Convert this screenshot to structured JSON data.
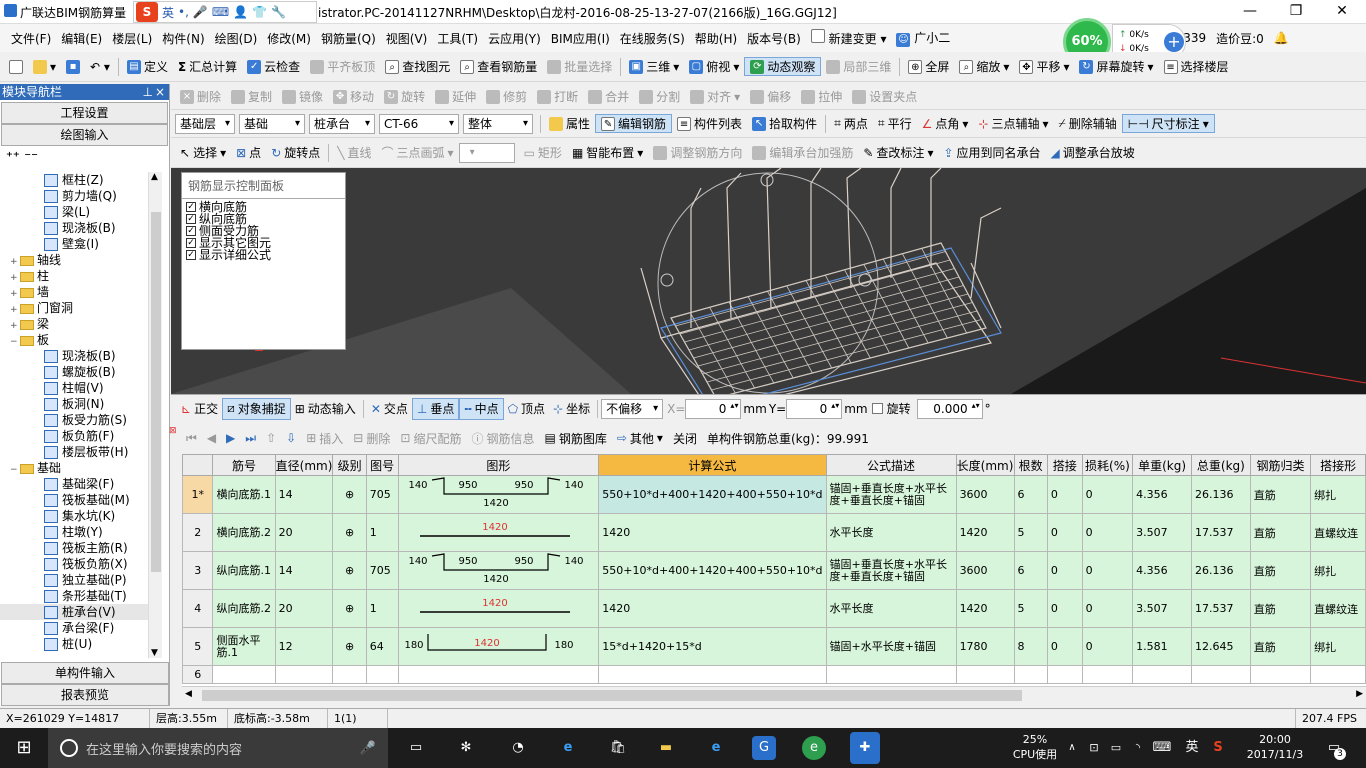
{
  "titlebar": {
    "app": "广联达BIM钢筋算量",
    "title": "istrator.PC-20141127NRHM\\Desktop\\白龙村-2016-08-25-13-27-07(2166版)_16G.GGJ12]",
    "ime_logo": "S",
    "ime_lang": "英",
    "min": "—",
    "max": "❐",
    "close": "✕"
  },
  "menu": [
    "文件(F)",
    "编辑(E)",
    "楼层(L)",
    "构件(N)",
    "绘图(D)",
    "修改(M)",
    "钢筋量(Q)",
    "视图(V)",
    "工具(T)",
    "云应用(Y)",
    "BIM应用(I)",
    "在线服务(S)",
    "帮助(H)",
    "版本号(B)",
    "新建变更",
    "广小二"
  ],
  "menu_right": {
    "num": "298339",
    "price": "造价豆:0"
  },
  "gauge": {
    "percent": "60%",
    "up": "0K/s",
    "down": "0K/s"
  },
  "toolbar1": [
    "定义",
    "汇总计算",
    "云检查",
    "平齐板顶",
    "查找图元",
    "查看钢筋量",
    "批量选择",
    "三维",
    "俯视",
    "动态观察",
    "局部三维",
    "全屏",
    "缩放",
    "平移",
    "屏幕旋转",
    "选择楼层"
  ],
  "toolbar2": [
    "删除",
    "复制",
    "镜像",
    "移动",
    "旋转",
    "延伸",
    "修剪",
    "打断",
    "合并",
    "分割",
    "对齐",
    "偏移",
    "拉伸",
    "设置夹点"
  ],
  "toolbar3": {
    "floor": "基础层",
    "type": "基础",
    "comp": "桩承台",
    "name": "CT-66",
    "mode": "整体",
    "items": [
      "属性",
      "编辑钢筋",
      "构件列表",
      "拾取构件",
      "两点",
      "平行",
      "点角",
      "三点辅轴",
      "删除辅轴",
      "尺寸标注"
    ]
  },
  "toolbar4": [
    "选择",
    "点",
    "旋转点",
    "直线",
    "三点画弧",
    "矩形",
    "智能布置",
    "调整钢筋方向",
    "编辑承台加强筋",
    "查改标注",
    "应用到同名承台",
    "调整承台放坡"
  ],
  "leftpanel": {
    "header": "模块导航栏",
    "pin": "⊥",
    "close": "×",
    "btn_project": "工程设置",
    "btn_draw": "绘图输入",
    "btn_single": "单构件输入",
    "btn_report": "报表预览"
  },
  "tree": [
    {
      "level": 2,
      "label": "框柱(Z)",
      "type": "leaf"
    },
    {
      "level": 2,
      "label": "剪力墙(Q)",
      "type": "leaf"
    },
    {
      "level": 2,
      "label": "梁(L)",
      "type": "leaf"
    },
    {
      "level": 2,
      "label": "现浇板(B)",
      "type": "leaf"
    },
    {
      "level": 2,
      "label": "壁龛(I)",
      "type": "leaf"
    },
    {
      "level": 1,
      "label": "轴线",
      "type": "folder",
      "exp": "+"
    },
    {
      "level": 1,
      "label": "柱",
      "type": "folder",
      "exp": "+"
    },
    {
      "level": 1,
      "label": "墙",
      "type": "folder",
      "exp": "+"
    },
    {
      "level": 1,
      "label": "门窗洞",
      "type": "folder",
      "exp": "+"
    },
    {
      "level": 1,
      "label": "梁",
      "type": "folder",
      "exp": "+"
    },
    {
      "level": 1,
      "label": "板",
      "type": "folder",
      "exp": "−"
    },
    {
      "level": 2,
      "label": "现浇板(B)",
      "type": "leaf"
    },
    {
      "level": 2,
      "label": "螺旋板(B)",
      "type": "leaf"
    },
    {
      "level": 2,
      "label": "柱帽(V)",
      "type": "leaf"
    },
    {
      "level": 2,
      "label": "板洞(N)",
      "type": "leaf"
    },
    {
      "level": 2,
      "label": "板受力筋(S)",
      "type": "leaf"
    },
    {
      "level": 2,
      "label": "板负筋(F)",
      "type": "leaf"
    },
    {
      "level": 2,
      "label": "楼层板带(H)",
      "type": "leaf"
    },
    {
      "level": 1,
      "label": "基础",
      "type": "folder",
      "exp": "−"
    },
    {
      "level": 2,
      "label": "基础梁(F)",
      "type": "leaf"
    },
    {
      "level": 2,
      "label": "筏板基础(M)",
      "type": "leaf"
    },
    {
      "level": 2,
      "label": "集水坑(K)",
      "type": "leaf"
    },
    {
      "level": 2,
      "label": "柱墩(Y)",
      "type": "leaf"
    },
    {
      "level": 2,
      "label": "筏板主筋(R)",
      "type": "leaf"
    },
    {
      "level": 2,
      "label": "筏板负筋(X)",
      "type": "leaf"
    },
    {
      "level": 2,
      "label": "独立基础(P)",
      "type": "leaf"
    },
    {
      "level": 2,
      "label": "条形基础(T)",
      "type": "leaf"
    },
    {
      "level": 2,
      "label": "桩承台(V)",
      "type": "leaf",
      "selected": true
    },
    {
      "level": 2,
      "label": "承台梁(F)",
      "type": "leaf"
    },
    {
      "level": 2,
      "label": "桩(U)",
      "type": "leaf"
    }
  ],
  "ctrlpanel": {
    "title": "钢筋显示控制面板",
    "items": [
      "横向底筋",
      "纵向底筋",
      "侧面受力筋",
      "显示其它图元",
      "显示详细公式"
    ]
  },
  "snapbar": {
    "items": [
      "正交",
      "对象捕捉",
      "动态输入",
      "交点",
      "垂点",
      "中点",
      "顶点",
      "坐标"
    ],
    "offset": "不偏移",
    "x_label": "X=",
    "x_val": "0",
    "y_label": "Y=",
    "y_val": "0",
    "unit": "mm",
    "rotate": "旋转",
    "rotate_val": "0.000",
    "deg": "°"
  },
  "gridbar": {
    "items": [
      "插入",
      "删除",
      "缩尺配筋",
      "钢筋信息",
      "钢筋图库",
      "其他",
      "关闭"
    ],
    "total": "单构件钢筋总重(kg)：99.991"
  },
  "grid": {
    "headers": [
      "",
      "筋号",
      "直径(mm)",
      "级别",
      "图号",
      "图形",
      "计算公式",
      "公式描述",
      "长度(mm)",
      "根数",
      "搭接",
      "损耗(%)",
      "单重(kg)",
      "总重(kg)",
      "钢筋归类",
      "搭接形"
    ],
    "rows": [
      {
        "no": "1*",
        "name": "横向底筋.1",
        "dia": "14",
        "grade": "⊕",
        "fig": "705",
        "shape": {
          "a": "140",
          "b": "950",
          "c": "1420",
          "d": "950",
          "e": "140"
        },
        "formula": "550+10*d+400+1420+400+550+10*d",
        "desc": "锚固+垂直长度+水平长度+垂直长度+锚固",
        "len": "3600",
        "count": "6",
        "lap": "0",
        "loss": "0",
        "uw": "4.356",
        "tw": "26.136",
        "cls": "直筋",
        "lapt": "绑扎"
      },
      {
        "no": "2",
        "name": "横向底筋.2",
        "dia": "20",
        "grade": "⊕",
        "fig": "1",
        "shape": {
          "c": "1420"
        },
        "formula": "1420",
        "desc": "水平长度",
        "len": "1420",
        "count": "5",
        "lap": "0",
        "loss": "0",
        "uw": "3.507",
        "tw": "17.537",
        "cls": "直筋",
        "lapt": "直螺纹连"
      },
      {
        "no": "3",
        "name": "纵向底筋.1",
        "dia": "14",
        "grade": "⊕",
        "fig": "705",
        "shape": {
          "a": "140",
          "b": "950",
          "c": "1420",
          "d": "950",
          "e": "140"
        },
        "formula": "550+10*d+400+1420+400+550+10*d",
        "desc": "锚固+垂直长度+水平长度+垂直长度+锚固",
        "len": "3600",
        "count": "6",
        "lap": "0",
        "loss": "0",
        "uw": "4.356",
        "tw": "26.136",
        "cls": "直筋",
        "lapt": "绑扎"
      },
      {
        "no": "4",
        "name": "纵向底筋.2",
        "dia": "20",
        "grade": "⊕",
        "fig": "1",
        "shape": {
          "c": "1420"
        },
        "formula": "1420",
        "desc": "水平长度",
        "len": "1420",
        "count": "5",
        "lap": "0",
        "loss": "0",
        "uw": "3.507",
        "tw": "17.537",
        "cls": "直筋",
        "lapt": "直螺纹连"
      },
      {
        "no": "5",
        "name": "侧面水平筋.1",
        "dia": "12",
        "grade": "⊕",
        "fig": "64",
        "shape": {
          "a": "180",
          "c": "1420",
          "e": "180"
        },
        "formula": "15*d+1420+15*d",
        "desc": "锚固+水平长度+锚固",
        "len": "1780",
        "count": "8",
        "lap": "0",
        "loss": "0",
        "uw": "1.581",
        "tw": "12.645",
        "cls": "直筋",
        "lapt": "绑扎"
      }
    ],
    "empty_no": "6"
  },
  "status": {
    "coords": "X=261029 Y=14817",
    "floor_h": "层高:3.55m",
    "base_h": "底标高:-3.58m",
    "count": "1(1)",
    "fps": "207.4 FPS"
  },
  "taskbar": {
    "search": "在这里输入你要搜索的内容",
    "cpu": "25%",
    "cpu_label": "CPU使用",
    "time": "20:00",
    "date": "2017/11/3",
    "lang": "英",
    "badge": "3"
  }
}
